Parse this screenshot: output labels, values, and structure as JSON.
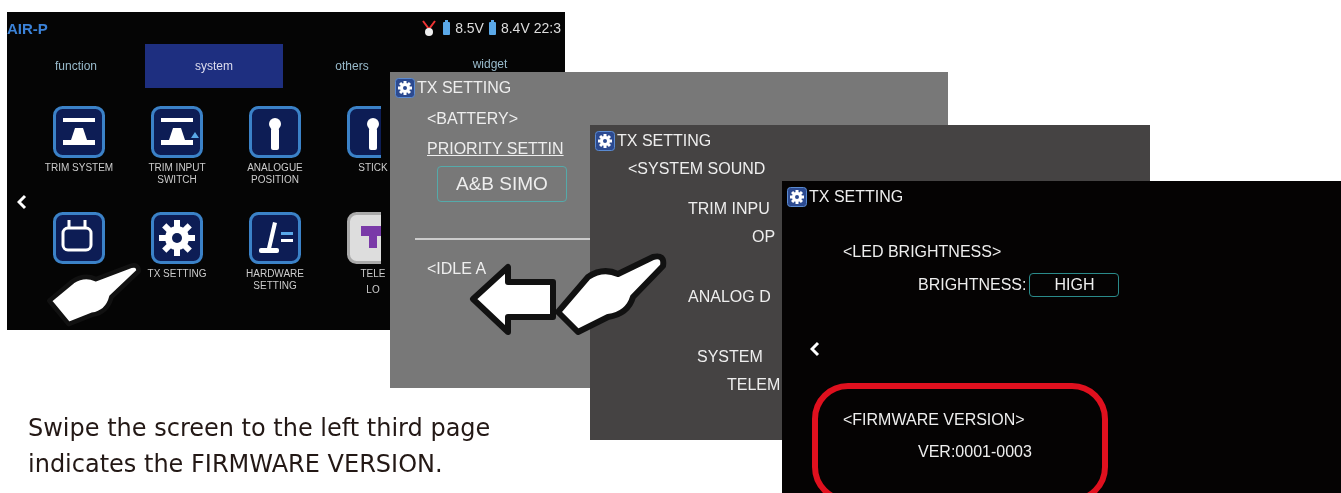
{
  "menu_screen": {
    "logo": "AIR-P",
    "status": {
      "voltage_a": "8.5V",
      "voltage_b": "8.4V",
      "time": "22:3"
    },
    "tabs": [
      {
        "label": "function",
        "selected": false
      },
      {
        "label": "system",
        "selected": true
      },
      {
        "label": "others",
        "selected": false
      },
      {
        "label": "widget",
        "selected": false
      }
    ],
    "icons": [
      {
        "kind": "trim",
        "label": "TRIM SYSTEM"
      },
      {
        "kind": "trim-switch",
        "label": "TRIM INPUT SWITCH"
      },
      {
        "kind": "stick",
        "label": "ANALOGUE POSITION"
      },
      {
        "kind": "stick",
        "label": "STICK"
      },
      {
        "kind": "radio"
      },
      {
        "kind": "gear",
        "label": "TX SETTING"
      },
      {
        "kind": "hardware",
        "label": "HARDWARE SETTING"
      },
      {
        "kind": "telemetry",
        "label": "TELE",
        "label_2": "LO"
      }
    ]
  },
  "setting_screens": [
    {
      "title": "TX SETTING",
      "lines": [
        {
          "kind": "heading",
          "text": "<BATTERY>"
        },
        {
          "kind": "link",
          "text": "PRIORITY SETTIN"
        },
        {
          "kind": "value",
          "text": "A&B SIMO"
        },
        {
          "kind": "divider"
        },
        {
          "kind": "heading",
          "text": "<IDLE A"
        }
      ]
    },
    {
      "title": "TX SETTING",
      "lines": [
        {
          "kind": "heading",
          "text": "<SYSTEM SOUND"
        },
        {
          "kind": "option",
          "text": "TRIM INPU"
        },
        {
          "kind": "sub",
          "text": "OP"
        },
        {
          "kind": "option-far",
          "text": "ANALOG D"
        },
        {
          "kind": "option-far",
          "text": "SYSTEM"
        },
        {
          "kind": "sub2",
          "text": "TELEM"
        }
      ]
    },
    {
      "title": "TX SETTING",
      "lines": [
        {
          "kind": "heading-top",
          "text": "<LED BRIGHTNESS>"
        },
        {
          "kind": "field",
          "label": "BRIGHTNESS:",
          "value": "HIGH"
        },
        {
          "kind": "back"
        },
        {
          "kind": "group",
          "highlighted": true,
          "lines": [
            {
              "kind": "heading",
              "text": "<FIRMWARE VERSION>"
            },
            {
              "kind": "option",
              "text": "VER:0001-0003"
            }
          ]
        }
      ]
    }
  ],
  "caption": [
    "Swipe the screen to the left third page",
    "indicates the FIRMWARE VERSION."
  ]
}
